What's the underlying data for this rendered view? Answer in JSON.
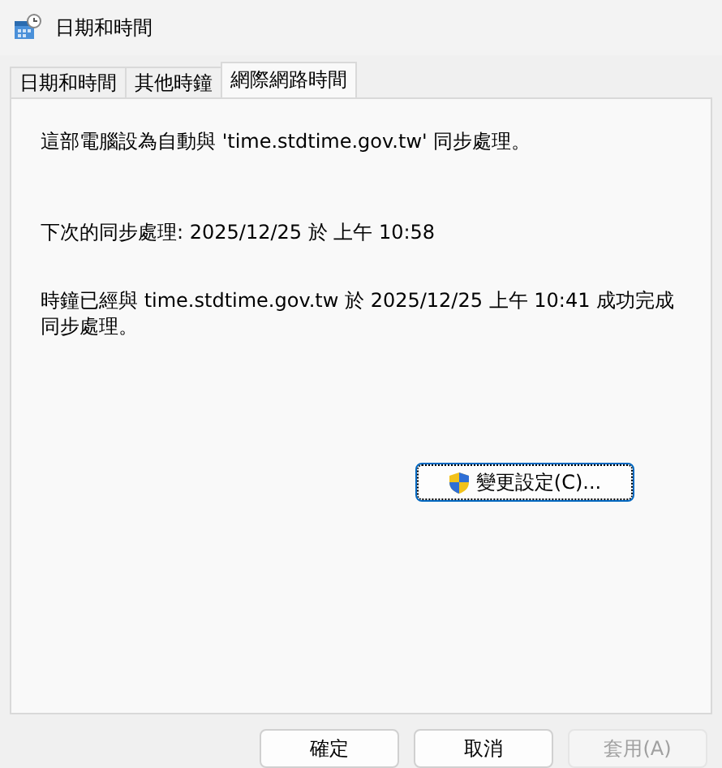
{
  "window": {
    "title": "日期和時間"
  },
  "tabs": [
    {
      "label": "日期和時間",
      "selected": false
    },
    {
      "label": "其他時鐘",
      "selected": false
    },
    {
      "label": "網際網路時間",
      "selected": true
    }
  ],
  "messages": [
    "這部電腦設為自動與 'time.stdtime.gov.tw' 同步處理。",
    "下次的同步處理: 2025/12/25 於 上午 10:58",
    "時鐘已經與 time.stdtime.gov.tw 於 2025/12/25 上午 10:41 成功完成同步處理。"
  ],
  "change_settings_button": {
    "label": "變更設定(C)..."
  },
  "buttons": [
    {
      "label": "確定",
      "disabled": false
    },
    {
      "label": "取消",
      "disabled": false
    },
    {
      "label": "套用(A)",
      "disabled": true
    }
  ]
}
